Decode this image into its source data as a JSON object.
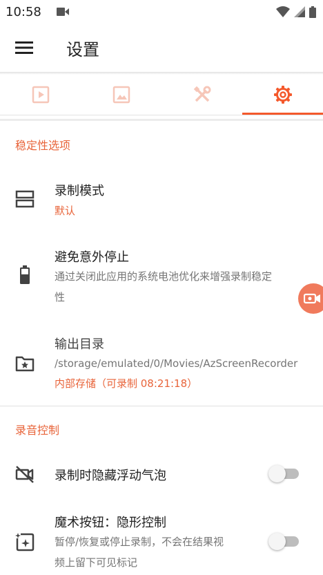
{
  "status_bar": {
    "time": "10:58"
  },
  "toolbar": {
    "title": "设置"
  },
  "tabs": [
    "video",
    "image",
    "tools",
    "settings"
  ],
  "colors": {
    "accent": "#e8643a",
    "tab_active": "#f4592c",
    "tab_inactive": "#f6c6b8"
  },
  "sections": {
    "stability": {
      "header": "稳定性选项",
      "record_mode": {
        "title": "录制模式",
        "value": "默认"
      },
      "avoid_stop": {
        "title": "避免意外停止",
        "line1": "通过关闭此应用的系统电池优化来增强录制稳定",
        "line2": "性"
      },
      "output_dir": {
        "title": "输出目录",
        "path": "/storage/emulated/0/Movies/AzScreenRecorder",
        "storage": "内部存储（可录制 08:21:18）"
      }
    },
    "audio": {
      "header": "录音控制",
      "hide_bubble": {
        "title": "录制时隐藏浮动气泡",
        "enabled": false
      },
      "magic_button": {
        "title": "魔术按钮：隐形控制",
        "line1": "暂停/恢复或停止录制，不会在结果视",
        "line2": "频上留下可见标记",
        "enabled": false
      }
    }
  }
}
